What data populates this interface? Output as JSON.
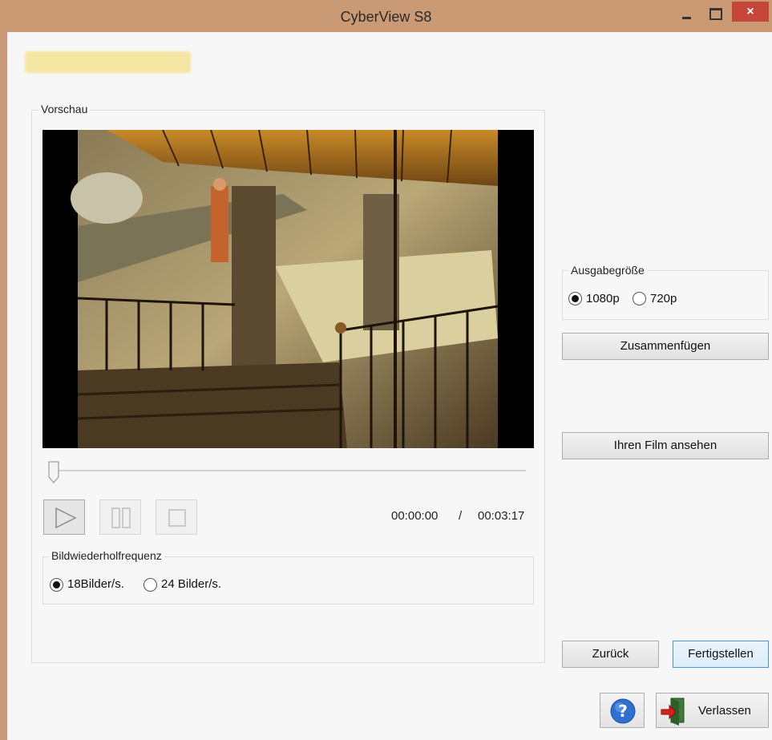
{
  "window": {
    "title": "CyberView S8",
    "controls": {
      "minimize": "minimize-icon",
      "maximize": "maximize-icon",
      "close": "×"
    }
  },
  "preview": {
    "label": "Vorschau",
    "slider_position": 0,
    "time_current": "00:00:00",
    "time_separator": "/",
    "time_total": "00:03:17",
    "controls": [
      "play-icon",
      "pause-icon",
      "stop-icon"
    ]
  },
  "frame_rate": {
    "label": "Bildwiederholfrequenz",
    "options": [
      {
        "label": "18Bilder/s.",
        "selected": true
      },
      {
        "label": "24 Bilder/s.",
        "selected": false
      }
    ]
  },
  "output_size": {
    "label": "Ausgabegröße",
    "options": [
      {
        "label": "1080p",
        "selected": true
      },
      {
        "label": "720p",
        "selected": false
      }
    ]
  },
  "buttons": {
    "merge": "Zusammenfügen",
    "view_film": "Ihren Film ansehen",
    "back": "Zurück",
    "finish": "Fertigstellen",
    "exit": "Verlassen",
    "help_icon": "help-icon",
    "exit_icon": "exit-door-icon"
  },
  "colors": {
    "titlebar": "#c99a74",
    "close_button": "#c7463c",
    "focus_border": "#4f95d6",
    "highlight_bar": "#f6e6a3"
  }
}
